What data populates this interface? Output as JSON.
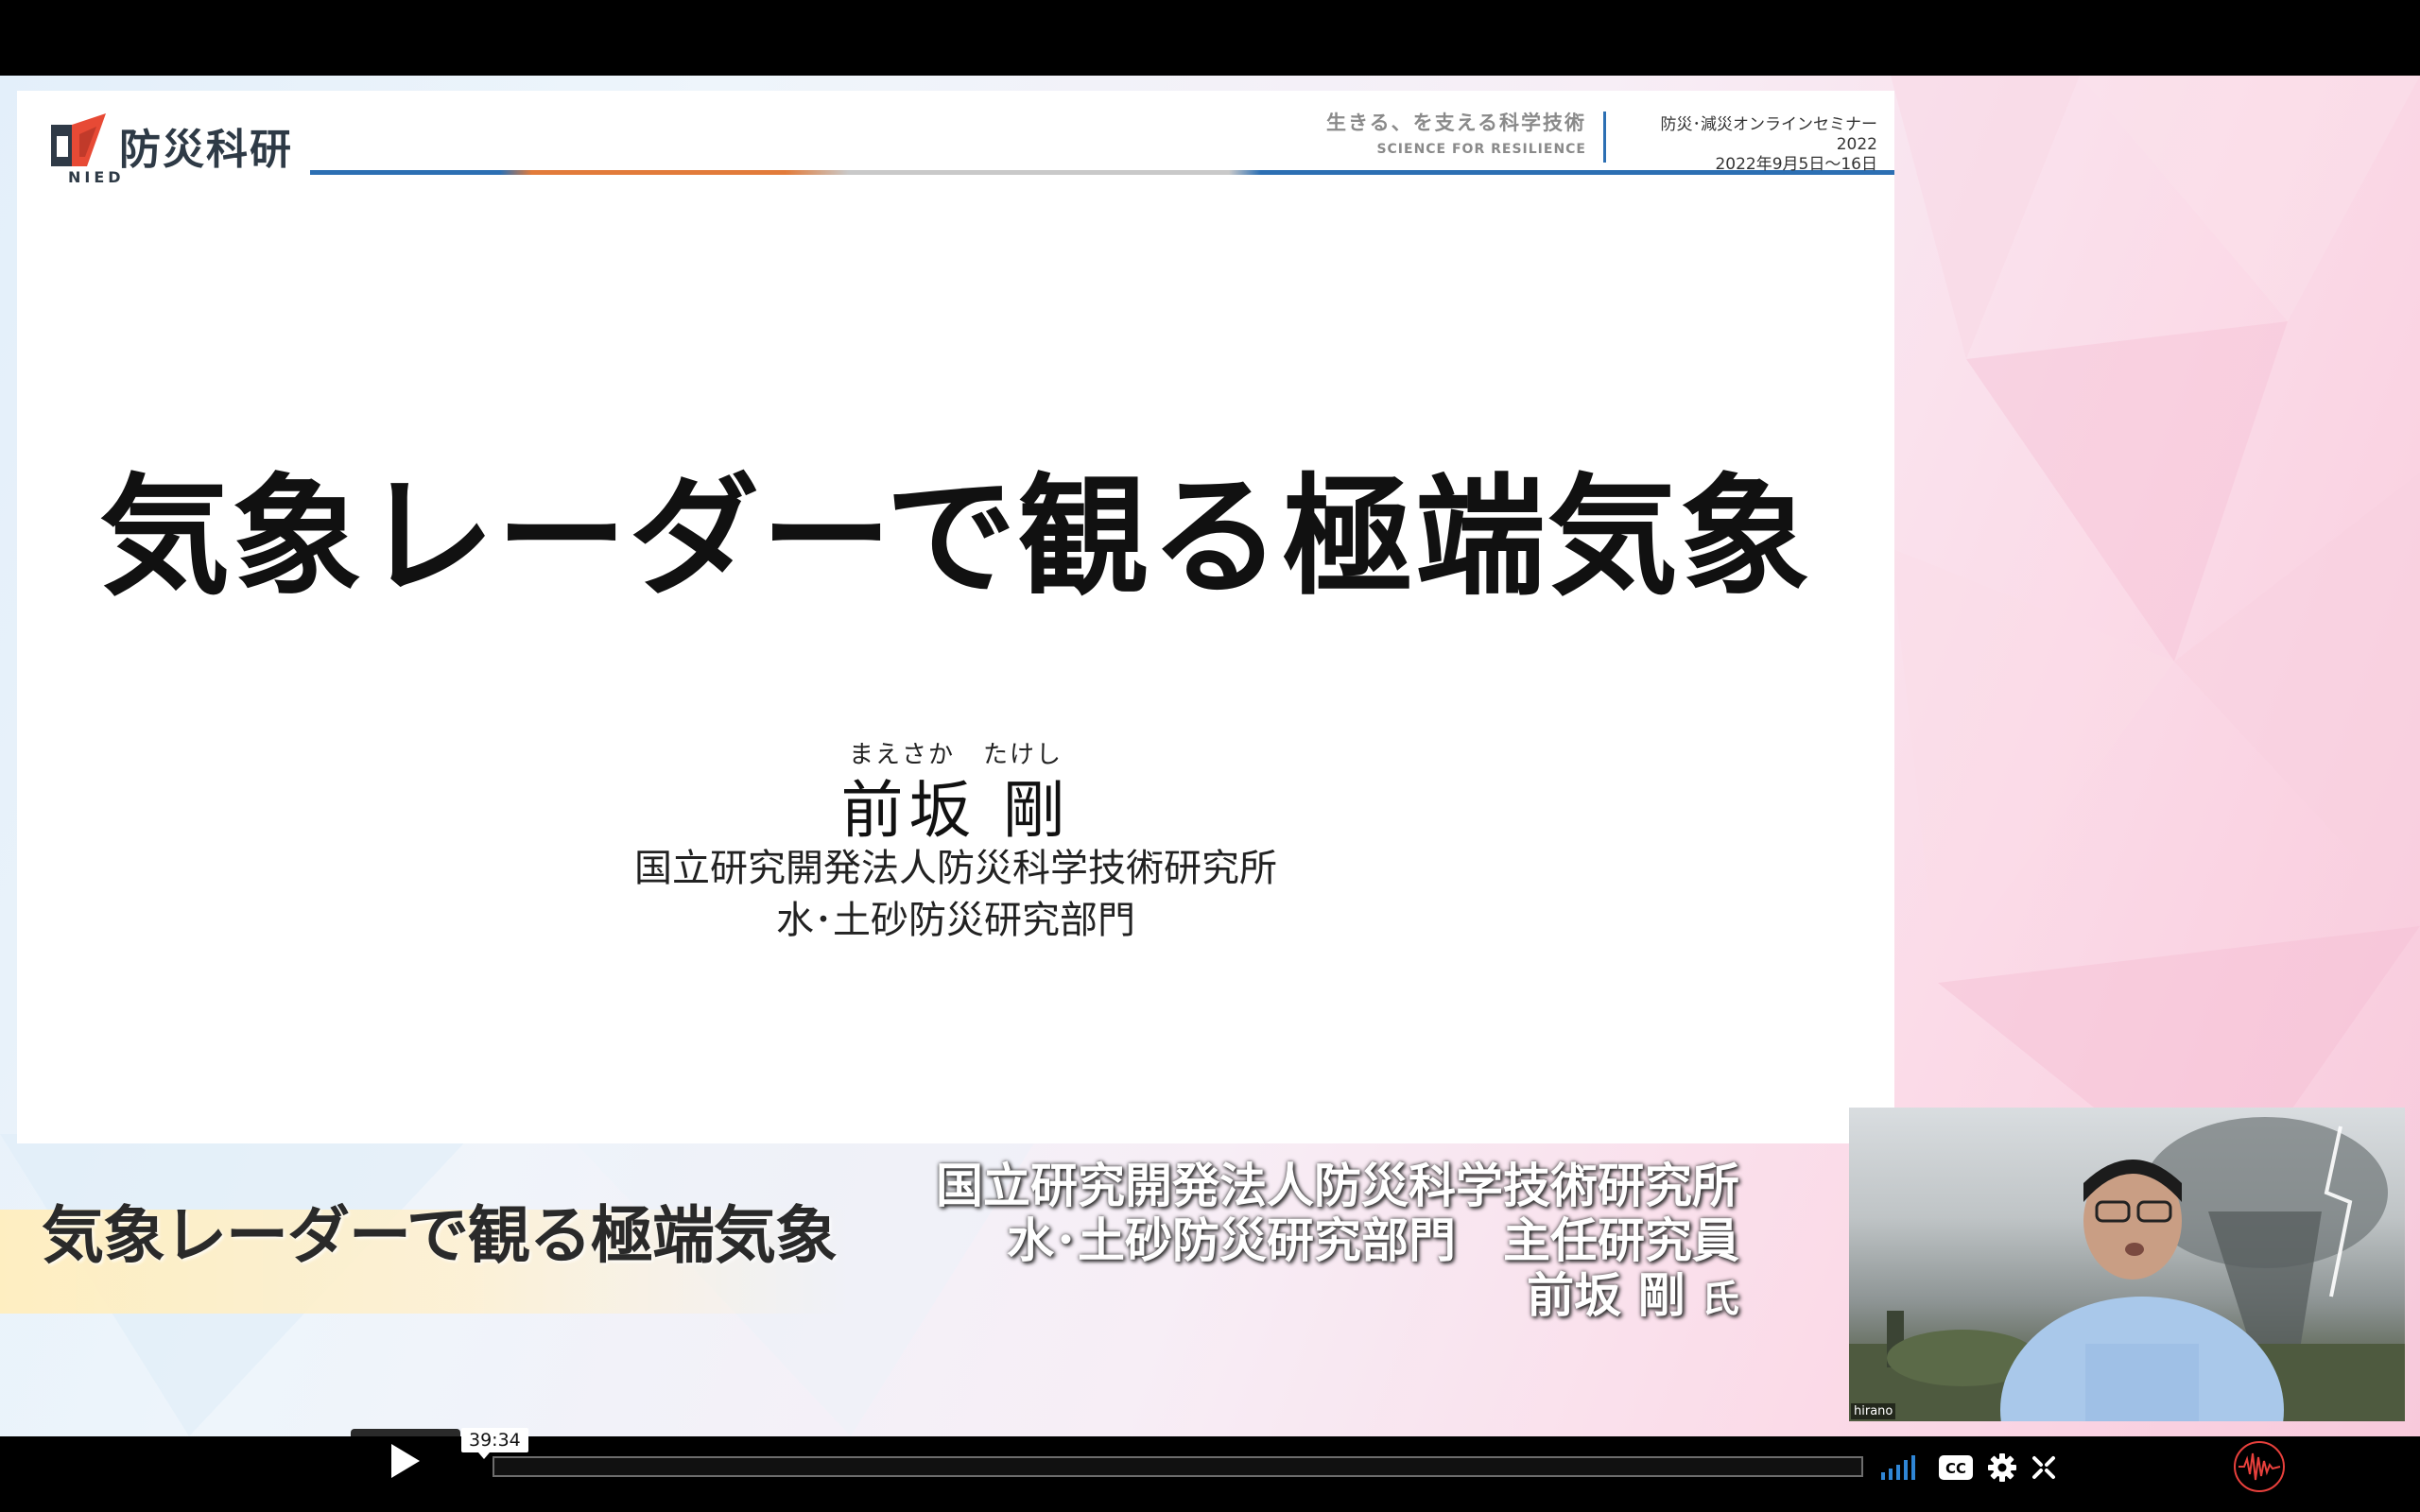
{
  "slide": {
    "logo_text": "防災科研",
    "logo_sub": "NIED",
    "tagline_jp": "生きる、を支える科学技術",
    "tagline_en": "SCIENCE FOR RESILIENCE",
    "event_line1": "防災･減災オンラインセミナー2022",
    "event_line2": "2022年9月5日～16日",
    "title": "気象レーダーで観る極端気象",
    "ruby_family": "まえさか",
    "ruby_given": "たけし",
    "speaker_name": "前坂 剛",
    "affiliation_1": "国立研究開発法人防災科学技術研究所",
    "affiliation_2": "水･土砂防災研究部門"
  },
  "lower_third": {
    "title": "気象レーダーで観る極端気象",
    "line1": "国立研究開発法人防災科学技術研究所",
    "line2": "水･土砂防災研究部門　主任研究員",
    "line3_name": "前坂 剛",
    "line3_suffix": "氏"
  },
  "webcam": {
    "label": "hirano"
  },
  "player": {
    "hover_time": "39:34",
    "progress_fraction": 0.0,
    "icons": [
      "play-icon",
      "volume-icon",
      "closed-captions-icon",
      "settings-icon",
      "fullscreen-icon",
      "vimeo-logo-icon"
    ],
    "colors": {
      "accent": "#e8403c",
      "controls_bg": "#000000"
    }
  }
}
